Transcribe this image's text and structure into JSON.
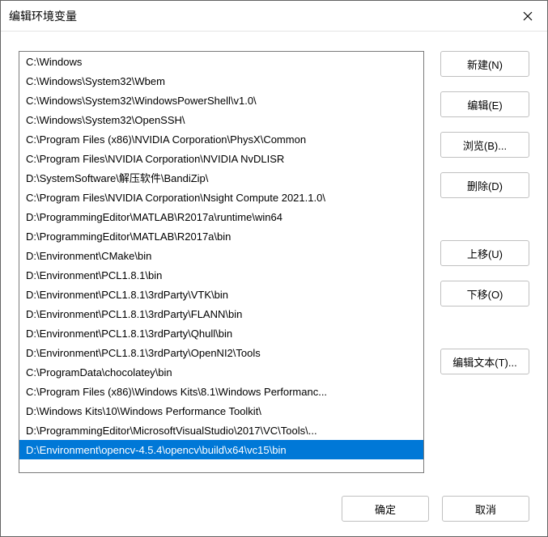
{
  "window": {
    "title": "编辑环境变量"
  },
  "list": {
    "items": [
      "C:\\Windows",
      "C:\\Windows\\System32\\Wbem",
      "C:\\Windows\\System32\\WindowsPowerShell\\v1.0\\",
      "C:\\Windows\\System32\\OpenSSH\\",
      "C:\\Program Files (x86)\\NVIDIA Corporation\\PhysX\\Common",
      "C:\\Program Files\\NVIDIA Corporation\\NVIDIA NvDLISR",
      "D:\\SystemSoftware\\解压软件\\BandiZip\\",
      "C:\\Program Files\\NVIDIA Corporation\\Nsight Compute 2021.1.0\\",
      "D:\\ProgrammingEditor\\MATLAB\\R2017a\\runtime\\win64",
      "D:\\ProgrammingEditor\\MATLAB\\R2017a\\bin",
      "D:\\Environment\\CMake\\bin",
      "D:\\Environment\\PCL1.8.1\\bin",
      "D:\\Environment\\PCL1.8.1\\3rdParty\\VTK\\bin",
      "D:\\Environment\\PCL1.8.1\\3rdParty\\FLANN\\bin",
      "D:\\Environment\\PCL1.8.1\\3rdParty\\Qhull\\bin",
      "D:\\Environment\\PCL1.8.1\\3rdParty\\OpenNI2\\Tools",
      "C:\\ProgramData\\chocolatey\\bin",
      "C:\\Program Files (x86)\\Windows Kits\\8.1\\Windows Performanc...",
      "D:\\Windows Kits\\10\\Windows Performance Toolkit\\",
      "D:\\ProgrammingEditor\\MicrosoftVisualStudio\\2017\\VC\\Tools\\...",
      "D:\\Environment\\opencv-4.5.4\\opencv\\build\\x64\\vc15\\bin"
    ],
    "selectedIndex": 20
  },
  "buttons": {
    "new": "新建(N)",
    "edit": "编辑(E)",
    "browse": "浏览(B)...",
    "delete": "删除(D)",
    "moveUp": "上移(U)",
    "moveDown": "下移(O)",
    "editText": "编辑文本(T)..."
  },
  "footer": {
    "ok": "确定",
    "cancel": "取消"
  }
}
